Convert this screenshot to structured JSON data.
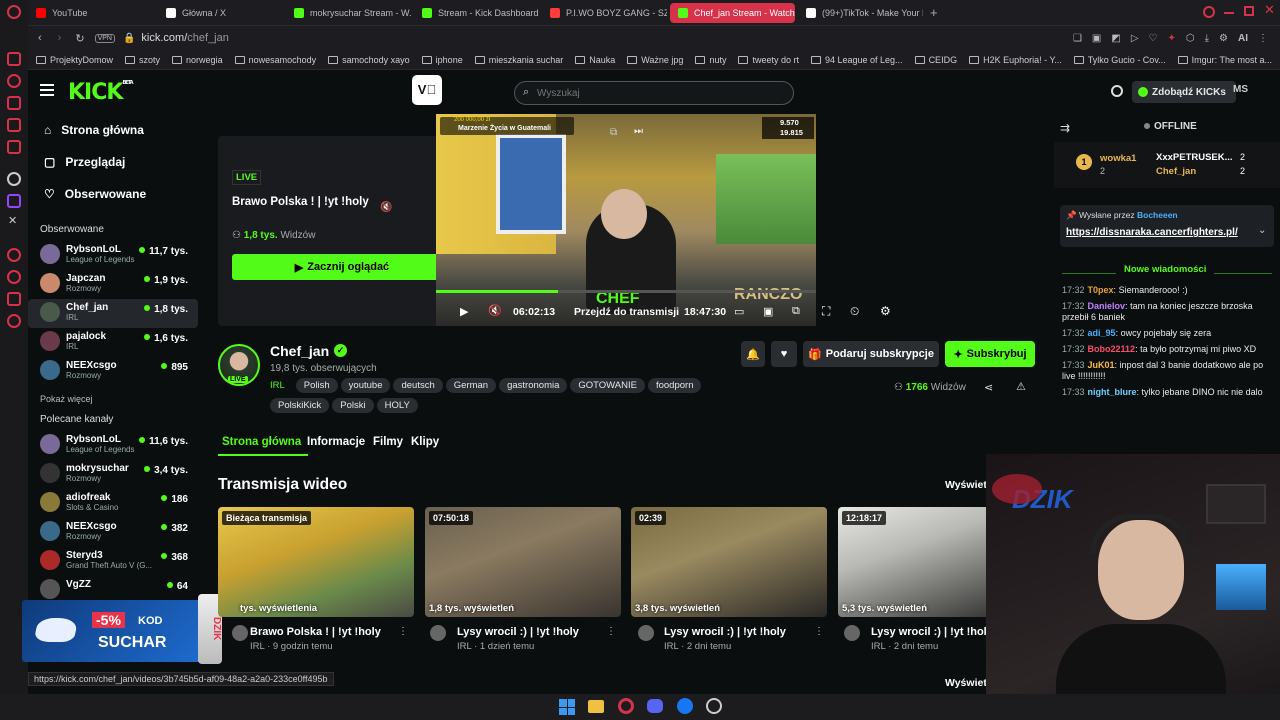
{
  "browser": {
    "tabs": [
      {
        "label": "YouTube",
        "color": "#ff0000"
      },
      {
        "label": "Główna / X",
        "color": "#ffffff"
      },
      {
        "label": "mokrysuchar Stream - W...",
        "color": "#53fc18"
      },
      {
        "label": "Stream - Kick Dashboard",
        "color": "#53fc18"
      },
      {
        "label": "P.I.WO BOYZ GANG - SZO...",
        "color": "#ff3b3b"
      },
      {
        "label": "Chef_jan Stream - Watch ...",
        "color": "#53fc18",
        "active": true
      },
      {
        "label": "(99+)TikTok - Make Your D...",
        "color": "#ffffff"
      }
    ],
    "new_tab": "+",
    "vpn": "VPN",
    "url": "kick.com/chef_jan",
    "url_prefix": "kick.com/",
    "url_path": "chef_jan",
    "ai_label": "AI",
    "bookmarks": [
      "ProjektyDomow",
      "szoty",
      "norwegia",
      "nowesamochody",
      "samochody xayo",
      "iphone",
      "mieszkania suchar",
      "Nauka",
      "Ważne jpg",
      "nuty",
      "tweety do rt",
      "94 League of Leg...",
      "CEIDG",
      "H2K Euphoria! - Y...",
      "Tylko Gucio - Cov...",
      "Imgur: The most a..."
    ],
    "status_url": "https://kick.com/chef_jan/videos/3b745b5d-af09-48a2-a2a0-233ce0ff495b"
  },
  "kick": {
    "logo": "KICK",
    "logo_sup": "BETA",
    "search_placeholder": "Wyszukaj",
    "get_kicks": "Zdobądź KICKs",
    "user_initials": "MS",
    "nav": [
      {
        "label": "Strona główna",
        "icon": "home-icon"
      },
      {
        "label": "Przeglądaj",
        "icon": "browse-icon"
      },
      {
        "label": "Obserwowane",
        "icon": "heart-icon"
      }
    ],
    "followed_title": "Obserwowane",
    "followed": [
      {
        "name": "RybsonLoL",
        "category": "League of Legends",
        "count": "11,7 tys.",
        "color": "#7a6a9a"
      },
      {
        "name": "Japczan",
        "category": "Rozmowy",
        "count": "1,9 tys.",
        "color": "#c88a6a"
      },
      {
        "name": "Chef_jan",
        "category": "IRL",
        "count": "1,8 tys.",
        "color": "#4a5a4a",
        "selected": true
      },
      {
        "name": "pajalock",
        "category": "IRL",
        "count": "1,6 tys.",
        "color": "#6a3a4a"
      },
      {
        "name": "NEEXcsgo",
        "category": "Rozmowy",
        "count": "895",
        "color": "#3a6a8a"
      }
    ],
    "show_more": "Pokaż więcej",
    "recommended_title": "Polecane kanały",
    "recommended": [
      {
        "name": "RybsonLoL",
        "category": "League of Legends",
        "count": "11,6 tys.",
        "color": "#7a6a9a"
      },
      {
        "name": "mokrysuchar",
        "category": "Rozmowy",
        "count": "3,4 tys.",
        "color": "#333333",
        "initials": "MS"
      },
      {
        "name": "adiofreak",
        "category": "Slots & Casino",
        "count": "186",
        "color": "#8a7a3a"
      },
      {
        "name": "NEEXcsgo",
        "category": "Rozmowy",
        "count": "382",
        "color": "#3a6a8a"
      },
      {
        "name": "Steryd3",
        "category": "Grand Theft Auto V (G...",
        "count": "368",
        "color": "#aa2a2a"
      },
      {
        "name": "VgZZ",
        "category": "",
        "count": "64",
        "color": "#555555"
      }
    ],
    "irl_tail": "IRL"
  },
  "player": {
    "live_badge": "LIVE",
    "stream_title": "Brawo Polska ! | !yt !holy",
    "viewers_num": "1,8 tys.",
    "viewers_label": "Widzów",
    "watch_button": "Zacznij oglądać",
    "elapsed": "06:02:13",
    "jump_label": "Przejdź do transmisji",
    "total": "18:47:30",
    "overlay_top": "Marzenie Życia w Guatemali",
    "overlay_amount": "200 000,00 zł",
    "overlay_a": "9.570",
    "overlay_b": "19.815",
    "watermark": "CHEF",
    "watermark2": "RANCZO",
    "progress": 0.32
  },
  "channel": {
    "name": "Chef_jan",
    "followers": "19,8 tys. obserwujących",
    "tags_row1": [
      "IRL",
      "Polish",
      "youtube",
      "deutsch",
      "German",
      "gastronomia",
      "GOTOWANIE",
      "foodporn"
    ],
    "tags_row2": [
      "PolskiKick",
      "Polski",
      "HOLY"
    ],
    "gift_button": "Podaruj subskrypcje",
    "sub_button": "Subskrybuj",
    "viewers": "1766",
    "viewers_label": "Widzów",
    "tabs": [
      "Strona główna",
      "Informacje",
      "Filmy",
      "Klipy"
    ],
    "section_title": "Transmisja wideo",
    "see_all": "Wyświetl",
    "see_all_bottom": "Wyświetl"
  },
  "videos": [
    {
      "tag": "Bieżąca transmisja",
      "views": "tys. wyświetlenia",
      "title": "Brawo Polska ! | !yt !holy",
      "meta": "IRL · 9 godzin temu"
    },
    {
      "tag": "07:50:18",
      "views": "1,8 tys. wyświetleń",
      "title": "Lysy wrocil :) | !yt !holy",
      "meta": "IRL · 1 dzień temu"
    },
    {
      "tag": "02:39",
      "views": "3,8 tys. wyświetleń",
      "title": "Lysy wrocil :) | !yt !holy",
      "meta": "IRL · 2 dni temu"
    },
    {
      "tag": "12:18:17",
      "views": "5,3 tys. wyświetleń",
      "title": "Lysy wrocil :) | !yt !holy",
      "meta": "IRL · 2 dni temu"
    }
  ],
  "chat": {
    "status": "OFFLINE",
    "top1_name": "wowka1",
    "top1_rank": "1",
    "top1_val": "2",
    "top2_name": "XxxPETRUSEK...",
    "top2_val": "2",
    "top3_name": "Chef_jan",
    "top3_val": "2",
    "pinned_by": "Wysłane przez",
    "pinned_user": "Bocheeen",
    "pinned_link": "https://dissnaraka.cancerfighters.pl/",
    "new_messages": "Nowe wiadomości",
    "messages": [
      {
        "time": "17:32",
        "user": "T0pex",
        "color": "#e8a33a",
        "text": "Siemanderooo! :)"
      },
      {
        "time": "17:32",
        "user": "Danielov",
        "color": "#c080ff",
        "text": "tam na koniec jeszcze brzoska przebił 6 baniek"
      },
      {
        "time": "17:32",
        "user": "adi_95",
        "color": "#4ab0ff",
        "text": "owcy pojebały się zera"
      },
      {
        "time": "17:32",
        "user": "Bobo22112",
        "color": "#ff4a6a",
        "text": "ta było potrzymaj mi piwo XD"
      },
      {
        "time": "17:33",
        "user": "JuK01",
        "color": "#ffb84a",
        "text": "inpost dal 3 banie dodatkowo ale po live !!!!!!!!!!!"
      },
      {
        "time": "17:33",
        "user": "night_blure",
        "color": "#6ad0ff",
        "text": "tylko jebane DINO nic nie dalo"
      }
    ]
  },
  "promo": {
    "discount": "-5%",
    "kod": "KOD",
    "code": "SUCHAR",
    "brand": "DZIK"
  },
  "webcam": {
    "logo": "DZIK"
  }
}
